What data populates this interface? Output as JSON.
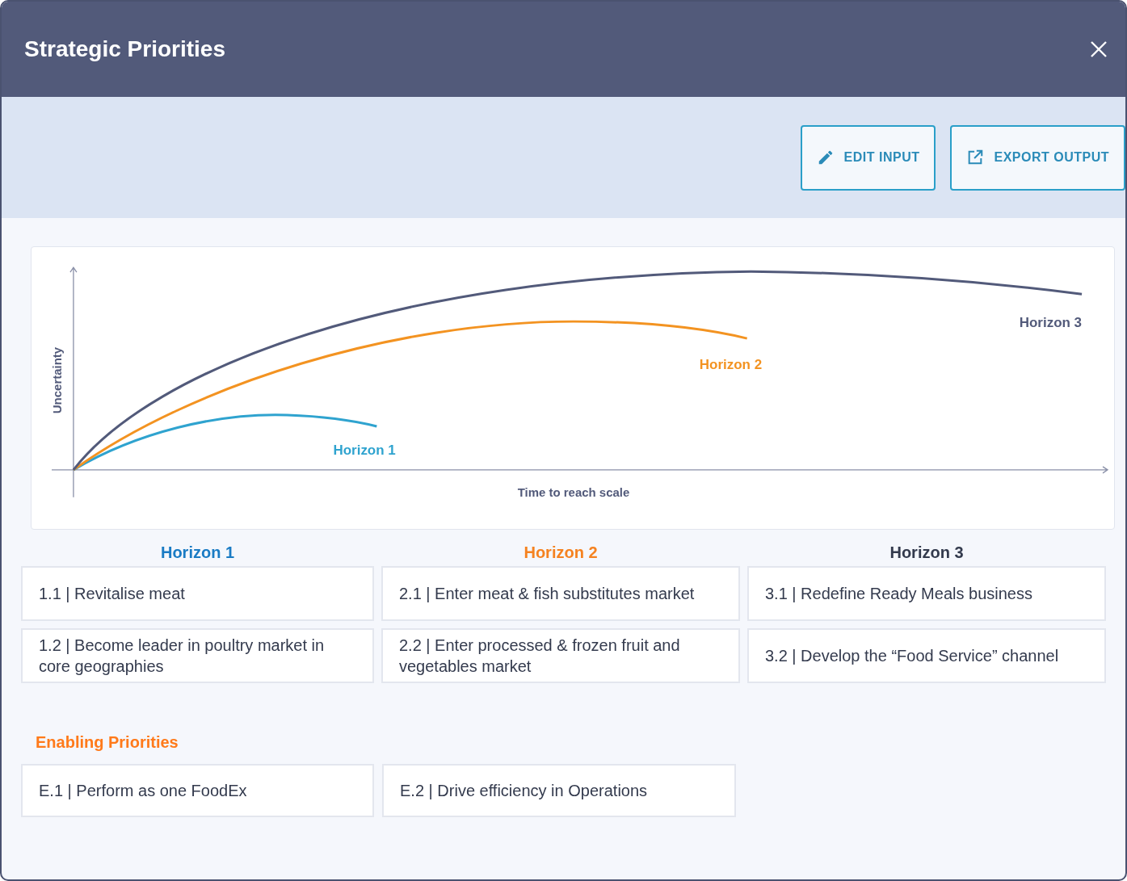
{
  "window": {
    "title": "Strategic Priorities"
  },
  "toolbar": {
    "buttons": [
      {
        "label": "EDIT INPUT",
        "kind": "edit"
      },
      {
        "label": "EXPORT OUTPUT",
        "kind": "export"
      }
    ]
  },
  "diagram": {
    "y_axis_label": "Uncertainty",
    "x_axis_label": "Time to reach scale",
    "curves": [
      {
        "label": "Horizon 1",
        "color": "#2fa3cf"
      },
      {
        "label": "Horizon 2",
        "color": "#f39321"
      },
      {
        "label": "Horizon 3",
        "color": "#525a7a"
      }
    ]
  },
  "horizons": [
    {
      "title": "Horizon 1",
      "color": "#1a7bc4",
      "priorities": [
        "1.1 | Revitalise meat",
        "1.2 | Become leader in poultry market in core geographies"
      ]
    },
    {
      "title": "Horizon 2",
      "color": "#f58220",
      "priorities": [
        "2.1 | Enter meat & fish substitutes market",
        "2.2 | Enter processed & frozen fruit and vegetables market"
      ]
    },
    {
      "title": "Horizon 3",
      "color": "#333a4d",
      "priorities": [
        "3.1 | Redefine Ready Meals business",
        "3.2 | Develop the “Food Service” channel"
      ]
    }
  ],
  "enabling": {
    "title": "Enabling Priorities",
    "priorities": [
      "E.1 | Perform as one FoodEx",
      "E.2 | Drive efficiency in Operations"
    ]
  }
}
